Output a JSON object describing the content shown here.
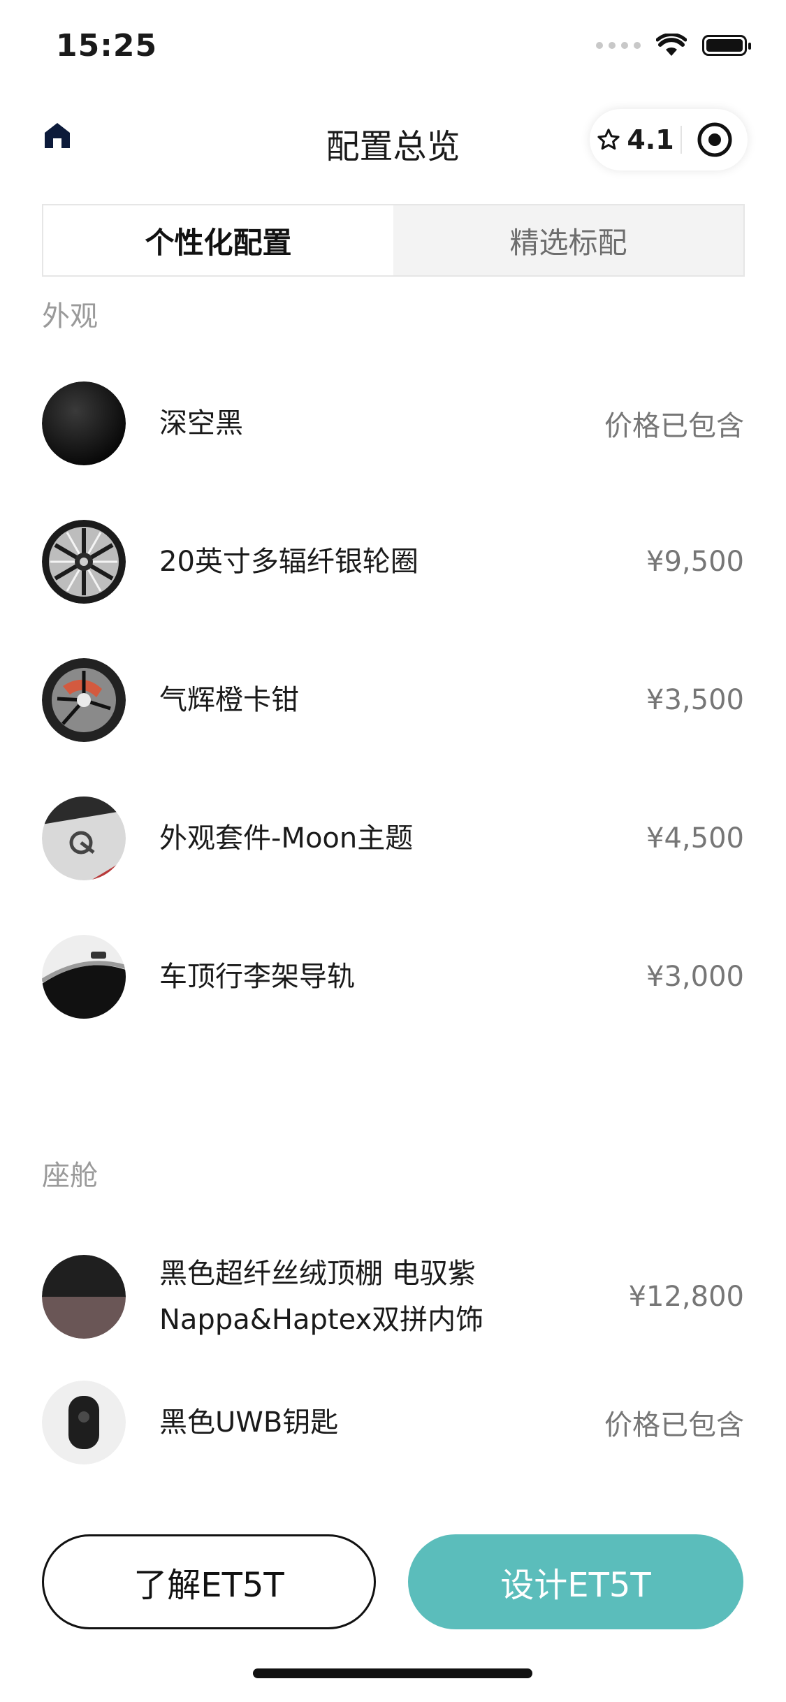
{
  "status_bar": {
    "time": "15:25"
  },
  "nav": {
    "title": "配置总览",
    "rating": "4.1"
  },
  "tabs": [
    {
      "label": "个性化配置",
      "active": true
    },
    {
      "label": "精选标配",
      "active": false
    }
  ],
  "sections": [
    {
      "title": "外观",
      "items": [
        {
          "name": "深空黑",
          "price": "价格已包含",
          "icon": "black-paint-swatch"
        },
        {
          "name": "20英寸多辐纤银轮圈",
          "price": "¥9,500",
          "icon": "wheel-rim"
        },
        {
          "name": "气辉橙卡钳",
          "price": "¥3,500",
          "icon": "orange-caliper"
        },
        {
          "name": "外观套件-Moon主题",
          "price": "¥4,500",
          "icon": "moon-kit-badge"
        },
        {
          "name": "车顶行李架导轨",
          "price": "¥3,000",
          "icon": "roof-rail"
        }
      ]
    },
    {
      "title": "座舱",
      "items": [
        {
          "name": "黑色超纤丝绒顶棚 电驭紫\nNappa&Haptex双拼内饰",
          "price": "¥12,800",
          "icon": "interior-swatch"
        },
        {
          "name": "黑色UWB钥匙",
          "price": "价格已包含",
          "icon": "uwb-key"
        }
      ]
    }
  ],
  "buttons": {
    "learn": "了解ET5T",
    "design": "设计ET5T"
  },
  "colors": {
    "accent": "#5bbdbb",
    "text": "#1a1a1a",
    "muted": "#9a9a9a"
  }
}
